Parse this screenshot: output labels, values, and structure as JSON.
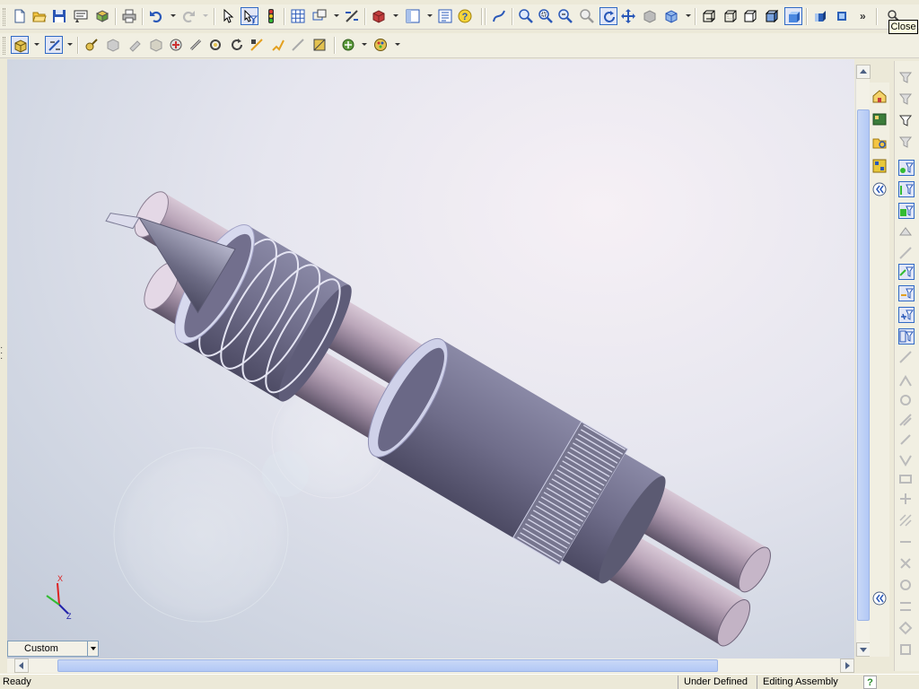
{
  "tooltip": {
    "close": "Close"
  },
  "toolbar_standard": {
    "buttons": [
      "new-document",
      "open",
      "save",
      "print-preview",
      "make-assembly",
      "print",
      "undo",
      "redo",
      "select",
      "select-filter",
      "traffic-light-rebuild",
      "grid-options",
      "view-sketch",
      "measure"
    ],
    "icons_view": [
      "zoom-to-fit",
      "zoom-area",
      "zoom-in-out",
      "zoom-selected",
      "rotate",
      "pan",
      "previous-view",
      "view-orientation",
      "wireframe",
      "hidden-lines-visible",
      "hidden-lines-removed",
      "shaded-with-edges",
      "shaded",
      "section-view",
      "perspective"
    ]
  },
  "toolbar_assembly": {
    "buttons": [
      "insert-component",
      "mate",
      "smart-fasteners",
      "move-component",
      "rotate-component",
      "explode",
      "interference-detection",
      "show-hidden",
      "assembly-features",
      "toolbox",
      "hole-series",
      "sketch",
      "exploded-line-sketch",
      "appearance"
    ]
  },
  "viewport": {
    "display_state": "Custom",
    "triad": {
      "x_label": "X",
      "z_label": "Z"
    }
  },
  "status": {
    "left": "Ready",
    "definition": "Under Defined",
    "mode": "Editing Assembly",
    "help": "?"
  },
  "colors": {
    "toolbar_bg": "#f1efe2",
    "scroll_thumb": "#b2c8f5",
    "part_metal": "#9a94a8",
    "background_top": "#f6f0f5",
    "background_bottom": "#c1c9d8"
  }
}
